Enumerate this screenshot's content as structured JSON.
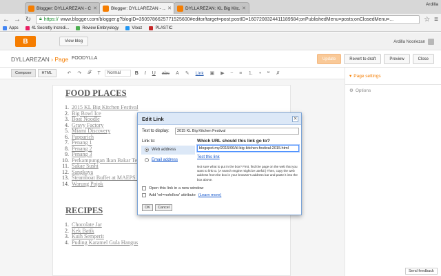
{
  "browser": {
    "tabs": [
      {
        "title": "Blogger: DYLLAREZAN - C...",
        "active": false
      },
      {
        "title": "Blogger: DYLLAREZAN - ...",
        "active": true
      },
      {
        "title": "DYLLAREZAN: KL Big Kitc...",
        "active": false
      }
    ],
    "user": "Ardilla",
    "url_scheme": "https://",
    "url_rest": "www.blogger.com/blogger.g?blogID=3509786625771525600#editor/target=post;postID=1607208324411189584;onPublishedMenu=posts;onClosedMenu=...",
    "bookmarks": [
      {
        "label": "Apps",
        "color": "#4285f4"
      },
      {
        "label": "41 Secretly Incredi...",
        "color": "#e91e63"
      },
      {
        "label": "Review Embryology",
        "color": "#4caf50"
      },
      {
        "label": "Vlooz",
        "color": "#2196f3"
      },
      {
        "label": "PLASTIC",
        "color": "#c62828"
      }
    ]
  },
  "blogger": {
    "view_blog": "View blog",
    "account_name": "Ardilla Nooriezan",
    "blog_name": "DYLLAREZAN",
    "separator": "›",
    "page_label": "Page",
    "post_title": "FOODYLLA",
    "actions": [
      "Update",
      "Revert to draft",
      "Preview",
      "Close"
    ]
  },
  "editor": {
    "mode_compose": "Compose",
    "mode_html": "HTML",
    "format_select": "Normal",
    "link_btn": "Link",
    "heading_food": "FOOD PLACES",
    "food_items": [
      "2015 KL Big Kitchen Festival",
      "Big Bowl Ice",
      "Boat Noodle",
      "Gravy Factory",
      "Miami Discovery",
      "Papparich",
      "Penang 1",
      "Penang 2",
      "Penang 3",
      "Perkampungan Ikan Bakar Te",
      "Sakae Sushi",
      "Sangkaya",
      "Steamboat Buffet at MAEPS I",
      "Warung Pojok"
    ],
    "heading_recipes": "RECIPES",
    "recipe_items": [
      "Chocolate Jar",
      "Kek Batik",
      "Kuih Semperit",
      "Puding Karamel Gula Hangus"
    ]
  },
  "sidebar": {
    "page_settings": "Page settings",
    "options": "Options",
    "send_feedback": "Send feedback"
  },
  "dialog": {
    "title": "Edit Link",
    "text_to_display_label": "Text to display:",
    "text_to_display_value": "2015 KL Big Kitchen Festival",
    "link_to_label": "Link to:",
    "web_address": "Web address",
    "email_address": "Email address",
    "url_question": "Which URL should this link go to?",
    "url_value": "blogspot.my/2015/06/kl-big-kitchen-festival-2015.html",
    "test_link": "Test this link",
    "help_text": "Not sure what to put in the box? First, find the page on the web that you want to link to. (A search engine might be useful.) Then, copy the web address from the box in your browser's address bar and paste it into the box above.",
    "new_window": "Open this link in a new window",
    "nofollow": "Add 'rel=nofollow' attribute",
    "learn_more": "(Learn more)",
    "ok": "OK",
    "cancel": "Cancel"
  },
  "colors": {
    "blogger_orange": "#f57d00",
    "dialog_title_bg": "#dce8f7",
    "link_blue": "#1155cc"
  }
}
